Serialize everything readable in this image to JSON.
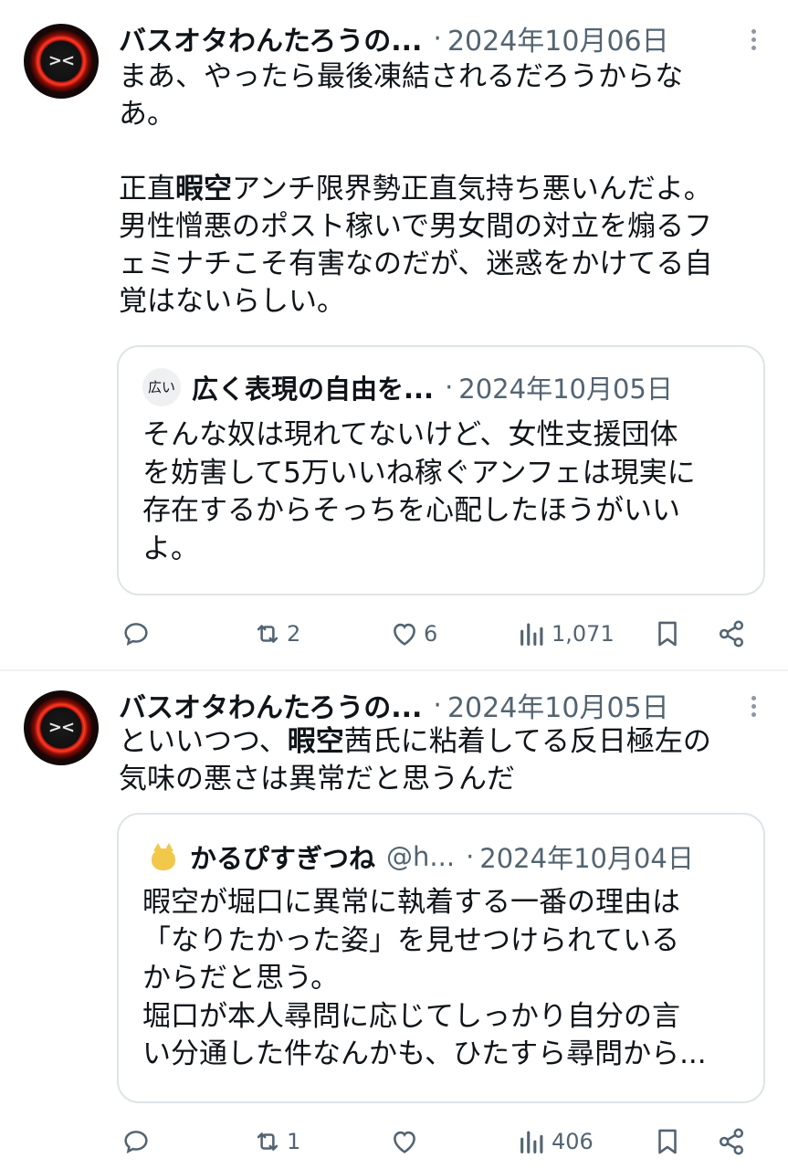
{
  "posts": [
    {
      "author_name": "バスオタわんたろうの...",
      "date": "2024年10月06日",
      "body": {
        "line1": "まあ、やったら最後凍結されるだろうからな",
        "line2": "あ。",
        "p2_before": "正直",
        "p2_highlight": "暇空",
        "p2_after": "アンチ限界勢正直気持ち悪いんだよ。",
        "line4": "男性憎悪のポスト稼いで男女間の対立を煽るフ",
        "line5": "ェミナチこそ有害なのだが、迷惑をかけてる自",
        "line6": "覚はないらしい。"
      },
      "quote": {
        "avatar_text": "広い",
        "author_name": "広く表現の自由を...",
        "date": "2024年10月05日",
        "lines": [
          "そんな奴は現れてないけど、女性支援団体",
          "を妨害して5万いいね稼ぐアンフェは現実に",
          "存在するからそっちを心配したほうがいい",
          "よ。"
        ]
      },
      "stats": {
        "reposts": "2",
        "likes": "6",
        "views": "1,071"
      }
    },
    {
      "author_name": "バスオタわんたろうの...",
      "date": "2024年10月05日",
      "body": {
        "before": "といいつつ、",
        "highlight": "暇空",
        "after": "茜氏に粘着してる反日極左の",
        "line2": "気味の悪さは異常だと思うんだ"
      },
      "quote": {
        "author_name": "かるぴすぎつね",
        "handle": "@h...",
        "date": "2024年10月04日",
        "lines": [
          "暇空が堀口に異常に執着する一番の理由は",
          "「なりたかった姿」を見せつけられている",
          "からだと思う。",
          "堀口が本人尋問に応じてしっかり自分の言",
          "い分通した件なんかも、ひたすら尋問から..."
        ]
      },
      "stats": {
        "reposts": "1",
        "likes": "",
        "views": "406"
      }
    }
  ],
  "colors": {
    "text": "#0f1419",
    "secondary": "#536471",
    "border": "#dfe4e8"
  },
  "icons": [
    "reply-icon",
    "repost-icon",
    "like-icon",
    "views-icon",
    "bookmark-icon",
    "share-icon",
    "more-icon"
  ]
}
